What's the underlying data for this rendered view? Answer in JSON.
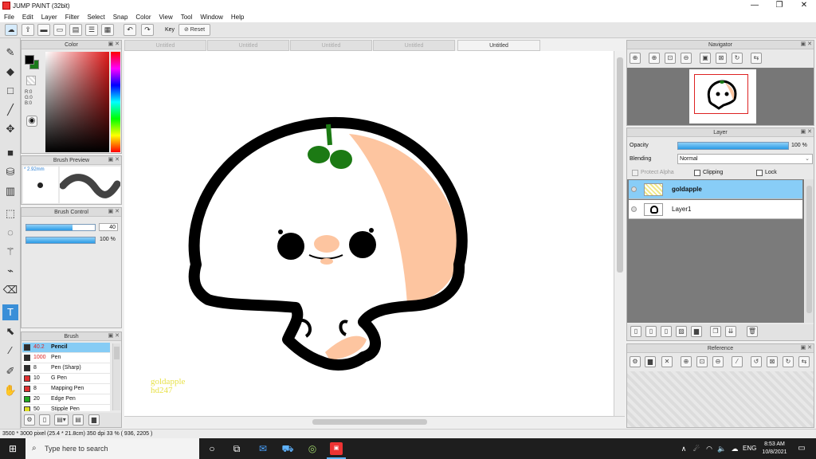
{
  "app": {
    "title": "JUMP PAINT (32bit)"
  },
  "window_controls": {
    "minimize": "—",
    "maximize": "❐",
    "close": "✕"
  },
  "menu": [
    "File",
    "Edit",
    "Layer",
    "Filter",
    "Select",
    "Snap",
    "Color",
    "View",
    "Tool",
    "Window",
    "Help"
  ],
  "toolbar": {
    "key_label": "Key",
    "reset_label": "Reset"
  },
  "color_panel": {
    "title": "Color",
    "r": "R:0",
    "g": "G:0",
    "b": "B:0",
    "foreground": "#000000",
    "background": "#1a7a1a"
  },
  "brush_preview": {
    "title": "Brush Preview",
    "size": "* 2.92mm"
  },
  "brush_control": {
    "title": "Brush Control",
    "size_value": "40",
    "opacity_value": "100 %",
    "size_level_pct": 68,
    "opacity_level_pct": 100
  },
  "brush_panel": {
    "title": "Brush",
    "items": [
      {
        "size": "40.2",
        "name": "Pencil",
        "color": "#2b2b2b",
        "selected": true
      },
      {
        "size": "1000",
        "name": "Pen",
        "color": "#2b2b2b",
        "selected": false
      },
      {
        "size": "8",
        "name": "Pen (Sharp)",
        "color": "#2b2b2b",
        "selected": false
      },
      {
        "size": "10",
        "name": "G Pen",
        "color": "#e03030",
        "selected": false
      },
      {
        "size": "8",
        "name": "Mapping Pen",
        "color": "#e03030",
        "selected": false
      },
      {
        "size": "20",
        "name": "Edge Pen",
        "color": "#22aa22",
        "selected": false
      },
      {
        "size": "50",
        "name": "Stipple Pen",
        "color": "#dddd22",
        "selected": false
      }
    ]
  },
  "tabs": [
    {
      "label": "Untitled",
      "active": false
    },
    {
      "label": "Untitled",
      "active": false
    },
    {
      "label": "Untitled",
      "active": false
    },
    {
      "label": "Untitled",
      "active": false
    },
    {
      "label": "Untitled",
      "active": true
    }
  ],
  "canvas": {
    "signature_line1": "goldapple",
    "signature_line2": "hd247"
  },
  "navigator": {
    "title": "Navigator"
  },
  "layer_panel": {
    "title": "Layer",
    "opacity_label": "Opacity",
    "opacity_value": "100 %",
    "opacity_level_pct": 100,
    "blending_label": "Blending",
    "blending_value": "Normal",
    "protect_alpha_label": "Protect Alpha",
    "clipping_label": "Clipping",
    "lock_label": "Lock",
    "layers": [
      {
        "name": "goldapple",
        "selected": true
      },
      {
        "name": "Layer1",
        "selected": false
      }
    ]
  },
  "reference": {
    "title": "Reference"
  },
  "status_bar": {
    "text": "3500 * 3000 pixel   (25.4 * 21.8cm)   350 dpi   33 %   ( 936, 2205 )"
  },
  "taskbar": {
    "search_placeholder": "Type here to search",
    "time": "8:53 AM",
    "date": "10/8/2021",
    "language": "ENG"
  }
}
